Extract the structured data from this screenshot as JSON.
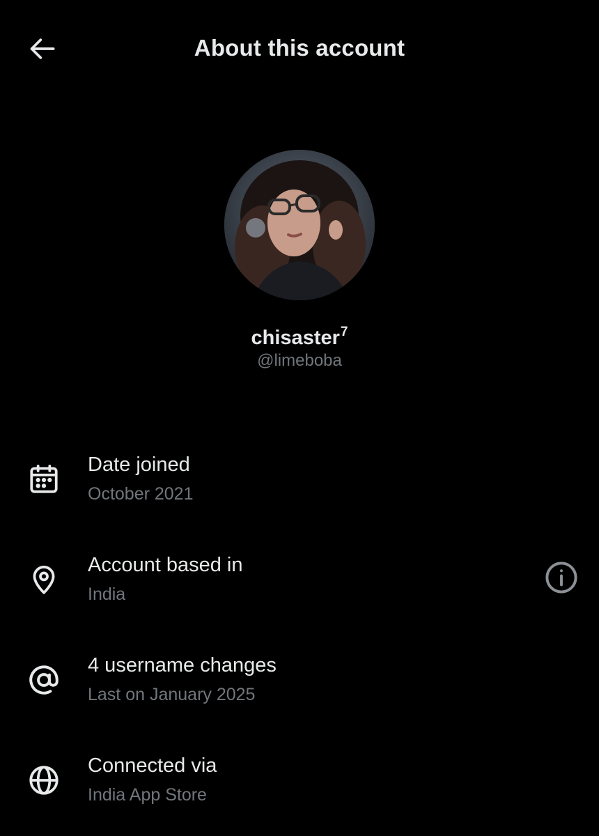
{
  "header": {
    "back_icon": "arrow-left-icon",
    "title": "About this account"
  },
  "profile": {
    "avatar_icon": "profile-photo",
    "display_name": "chisaster",
    "display_name_superscript": "7",
    "handle": "@limeboba"
  },
  "rows": [
    {
      "icon": "calendar-icon",
      "title": "Date joined",
      "subtitle": "October 2021"
    },
    {
      "icon": "location-pin-icon",
      "title": "Account based in",
      "subtitle": "India",
      "action_icon": "info-icon"
    },
    {
      "icon": "at-sign-icon",
      "title": "4 username changes",
      "subtitle": "Last on January 2025"
    },
    {
      "icon": "globe-icon",
      "title": "Connected via",
      "subtitle": "India App Store"
    }
  ],
  "colors": {
    "background": "#000000",
    "primary_text": "#e7e9ea",
    "secondary_text": "#71767b"
  }
}
